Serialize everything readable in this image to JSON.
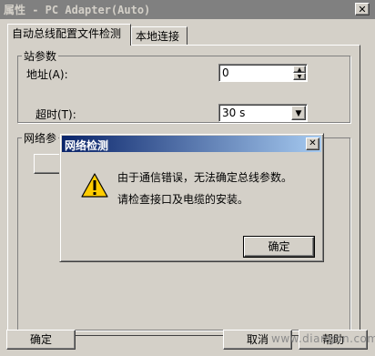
{
  "window": {
    "title": "属性 - PC Adapter(Auto)"
  },
  "tabs": [
    {
      "label": "自动总线配置文件检测",
      "active": true
    },
    {
      "label": "本地连接",
      "active": false
    }
  ],
  "station_group": {
    "legend": "站参数",
    "address_label": "地址(A):",
    "address_value": "0",
    "timeout_label": "超时(T):",
    "timeout_value": "30 s"
  },
  "network_group": {
    "legend": "网络参"
  },
  "dialog": {
    "title": "网络检测",
    "icon": "warning-icon",
    "message_line1": "由于通信错误，无法确定总线参数。",
    "message_line2": "请检查接口及电缆的安装。",
    "ok_label": "确定"
  },
  "footer": {
    "ok_label": "确定",
    "cancel_label": "取消",
    "help_label": "帮助"
  },
  "watermark": "www.diangon.com"
}
